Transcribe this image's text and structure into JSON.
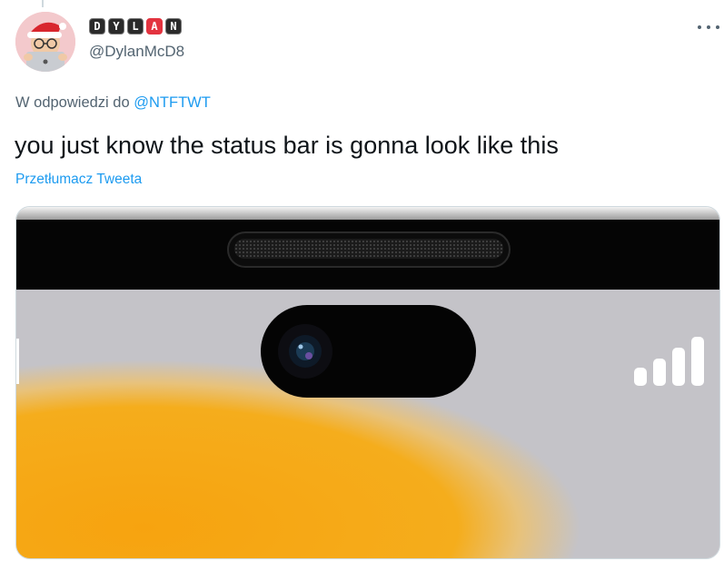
{
  "tweet": {
    "display_name_tiles": [
      "D",
      "Y",
      "L",
      "A",
      "N"
    ],
    "highlight_tile_index": 3,
    "handle": "@DylanMcD8",
    "reply_prefix": "W odpowiedzi do",
    "reply_to": "@NTFTWT",
    "text": "you just know the status bar is gonna look like this",
    "translate_label": "Przetłumacz Tweeta"
  },
  "icons": {
    "more": "more-options-icon",
    "avatar": "memoji-avatar-santa-hat",
    "signal": "cellular-signal-icon"
  },
  "colors": {
    "link": "#1d9bf0",
    "secondary_text": "#536471",
    "primary_text": "#0f1419",
    "highlight_tile": "#e3333f",
    "wallpaper_orange": "#f5a912",
    "wallpaper_gray": "#c4c3c8"
  },
  "media": {
    "signal_bars_filled": 4
  }
}
